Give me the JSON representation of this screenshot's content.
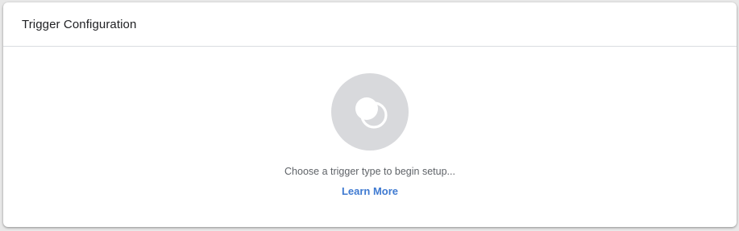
{
  "panel": {
    "title": "Trigger Configuration"
  },
  "empty_state": {
    "icon": "trigger-icon",
    "hint": "Choose a trigger type to begin setup...",
    "learn_more_label": "Learn More"
  },
  "colors": {
    "icon_circle_bg": "#d8d9dc",
    "link": "#3f7ad1",
    "hint_text": "#5f6368"
  }
}
